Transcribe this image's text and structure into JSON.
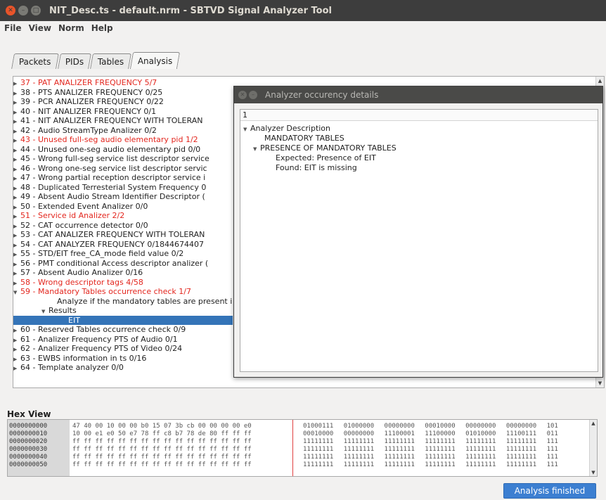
{
  "window": {
    "title": "NIT_Desc.ts - default.nrm - SBTVD Signal Analyzer Tool"
  },
  "menu": [
    "File",
    "View",
    "Norm",
    "Help"
  ],
  "tabs": [
    {
      "label": "Packets",
      "active": false
    },
    {
      "label": "PIDs",
      "active": false
    },
    {
      "label": "Tables",
      "active": false
    },
    {
      "label": "Analysis",
      "active": true
    }
  ],
  "tree": [
    {
      "text": "37 - PAT ANALIZER FREQUENCY  5/7",
      "red": true,
      "arrow": "right",
      "indent": 0
    },
    {
      "text": "38 - PTS ANALIZER FREQUENCY  0/25",
      "red": false,
      "arrow": "right",
      "indent": 0
    },
    {
      "text": "39 - PCR ANALIZER FREQUENCY  0/22",
      "red": false,
      "arrow": "right",
      "indent": 0
    },
    {
      "text": "40 - NIT ANALIZER FREQUENCY  0/1",
      "red": false,
      "arrow": "right",
      "indent": 0
    },
    {
      "text": "41 - NIT ANALIZER FREQUENCY WITH TOLERAN",
      "red": false,
      "arrow": "right",
      "indent": 0
    },
    {
      "text": "42 - Audio StreamType Analizer  0/2",
      "red": false,
      "arrow": "right",
      "indent": 0
    },
    {
      "text": "43 - Unused full-seg audio elementary pid  1/2",
      "red": true,
      "arrow": "right",
      "indent": 0
    },
    {
      "text": "44 - Unused one-seg audio elementary pid  0/0",
      "red": false,
      "arrow": "right",
      "indent": 0
    },
    {
      "text": "45 - Wrong full-seg service list descriptor service",
      "red": false,
      "arrow": "right",
      "indent": 0
    },
    {
      "text": "46 - Wrong one-seg service list descriptor servic",
      "red": false,
      "arrow": "right",
      "indent": 0
    },
    {
      "text": "47 - Wrong partial reception descriptor service i",
      "red": false,
      "arrow": "right",
      "indent": 0
    },
    {
      "text": "48 - Duplicated Terresterial System Frequency  0",
      "red": false,
      "arrow": "right",
      "indent": 0
    },
    {
      "text": "49 - Absent Audio Stream Identifier Descriptor  (",
      "red": false,
      "arrow": "right",
      "indent": 0
    },
    {
      "text": "50 - Extended Event Analizer  0/0",
      "red": false,
      "arrow": "right",
      "indent": 0
    },
    {
      "text": "51 - Service id Analizer  2/2",
      "red": true,
      "arrow": "right",
      "indent": 0
    },
    {
      "text": "52 - CAT occurrence detector  0/0",
      "red": false,
      "arrow": "right",
      "indent": 0
    },
    {
      "text": "53 - CAT ANALIZER FREQUENCY WITH TOLERAN",
      "red": false,
      "arrow": "right",
      "indent": 0
    },
    {
      "text": "54 - CAT ANALYZER FREQUENCY  0/1844674407",
      "red": false,
      "arrow": "right",
      "indent": 0
    },
    {
      "text": "55 - STD/EIT free_CA_mode field value  0/2",
      "red": false,
      "arrow": "right",
      "indent": 0
    },
    {
      "text": "56 - PMT conditional Access descriptor analizer  (",
      "red": false,
      "arrow": "right",
      "indent": 0
    },
    {
      "text": "57 - Absent Audio Analizer  0/16",
      "red": false,
      "arrow": "right",
      "indent": 0
    },
    {
      "text": "58 - Wrong descriptor tags  4/58",
      "red": true,
      "arrow": "right",
      "indent": 0
    },
    {
      "text": "59 - Mandatory Tables occurrence check  1/7",
      "red": true,
      "arrow": "down",
      "indent": 0
    },
    {
      "text": "Analyze if the mandatory tables are present i",
      "red": false,
      "arrow": "",
      "indent": 1
    },
    {
      "text": "Results",
      "red": false,
      "arrow": "down",
      "indent": 1
    },
    {
      "text": "EIT",
      "red": false,
      "arrow": "",
      "indent": 2,
      "selected": true
    },
    {
      "text": "60 - Reserved Tables occurrence check  0/9",
      "red": false,
      "arrow": "right",
      "indent": 0
    },
    {
      "text": "61 -  Analizer Frequency PTS of Audio  0/1",
      "red": false,
      "arrow": "right",
      "indent": 0
    },
    {
      "text": "62 -  Analizer Frequency PTS of Video  0/24",
      "red": false,
      "arrow": "right",
      "indent": 0
    },
    {
      "text": "63 - EWBS information in ts  0/16",
      "red": false,
      "arrow": "right",
      "indent": 0
    },
    {
      "text": "64 - Template analyzer  0/0",
      "red": false,
      "arrow": "right",
      "indent": 0
    }
  ],
  "dialog": {
    "title": "Analyzer occurency details",
    "header": "1",
    "rows": [
      {
        "text": "Analyzer Description",
        "arrow": "down",
        "indent": 0
      },
      {
        "text": "MANDATORY TABLES",
        "arrow": "",
        "indent": 1
      },
      {
        "text": "PRESENCE OF MANDATORY TABLES",
        "arrow": "down",
        "indent": 1
      },
      {
        "text": "Expected: Presence of EIT",
        "arrow": "",
        "indent": 2
      },
      {
        "text": "Found: EIT is missing",
        "arrow": "",
        "indent": 2
      }
    ]
  },
  "hex": {
    "label": "Hex View",
    "rows": [
      {
        "offset": "0000000000",
        "bytes": "47 40 00 10 00 00 b0 15 07 3b cb 00 00 00 00 e0",
        "bin": "01000111 01000000 00000000 00010000 00000000 00000000 101"
      },
      {
        "offset": "0000000010",
        "bytes": "10 00 e1 e0 50 e7 78 ff c8 b7 78 de 80 ff ff ff",
        "bin": "00010000 00000000 11100001 11100000 01010000 11100111 011"
      },
      {
        "offset": "0000000020",
        "bytes": "ff ff ff ff ff ff ff ff ff ff ff ff ff ff ff ff",
        "bin": "11111111 11111111 11111111 11111111 11111111 11111111 111"
      },
      {
        "offset": "0000000030",
        "bytes": "ff ff ff ff ff ff ff ff ff ff ff ff ff ff ff ff",
        "bin": "11111111 11111111 11111111 11111111 11111111 11111111 111"
      },
      {
        "offset": "0000000040",
        "bytes": "ff ff ff ff ff ff ff ff ff ff ff ff ff ff ff ff",
        "bin": "11111111 11111111 11111111 11111111 11111111 11111111 111"
      },
      {
        "offset": "0000000050",
        "bytes": "ff ff ff ff ff ff ff ff ff ff ff ff ff ff ff ff",
        "bin": "11111111 11111111 11111111 11111111 11111111 11111111 111"
      }
    ]
  },
  "status": {
    "label": "Analysis finished"
  },
  "colors": {
    "red_text": "#e3261e",
    "selection": "#3474b8",
    "status_button": "#3c7fd1"
  }
}
